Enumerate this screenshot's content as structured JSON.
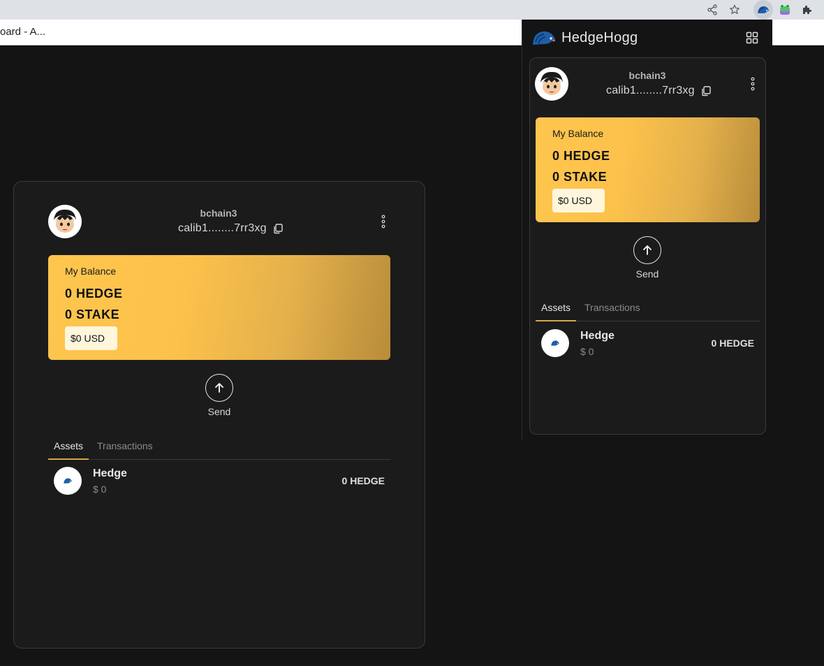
{
  "browser": {
    "tab_title": "oard - A...",
    "icons": [
      "share-icon",
      "star-icon",
      "hedgehog-extension-icon",
      "frog-extension-icon",
      "puzzle-icon"
    ]
  },
  "popup": {
    "brand": "HedgeHogg"
  },
  "wallet": {
    "account_name": "bchain3",
    "address": "calib1........7rr3xg",
    "balance_label": "My Balance",
    "hedge_balance": "0 HEDGE",
    "stake_balance": "0 STAKE",
    "usd_value": "$0 USD",
    "send_label": "Send",
    "tabs": [
      {
        "label": "Assets",
        "active": true
      },
      {
        "label": "Transactions",
        "active": false
      }
    ],
    "assets": [
      {
        "name": "Hedge",
        "usd": "$ 0",
        "amount": "0 HEDGE"
      }
    ]
  },
  "colors": {
    "background": "#141414",
    "card": "#1b1b1c",
    "accent": "#d4a64b",
    "balance_gradient_start": "#ffc64e",
    "balance_gradient_end": "#b88c3a"
  }
}
